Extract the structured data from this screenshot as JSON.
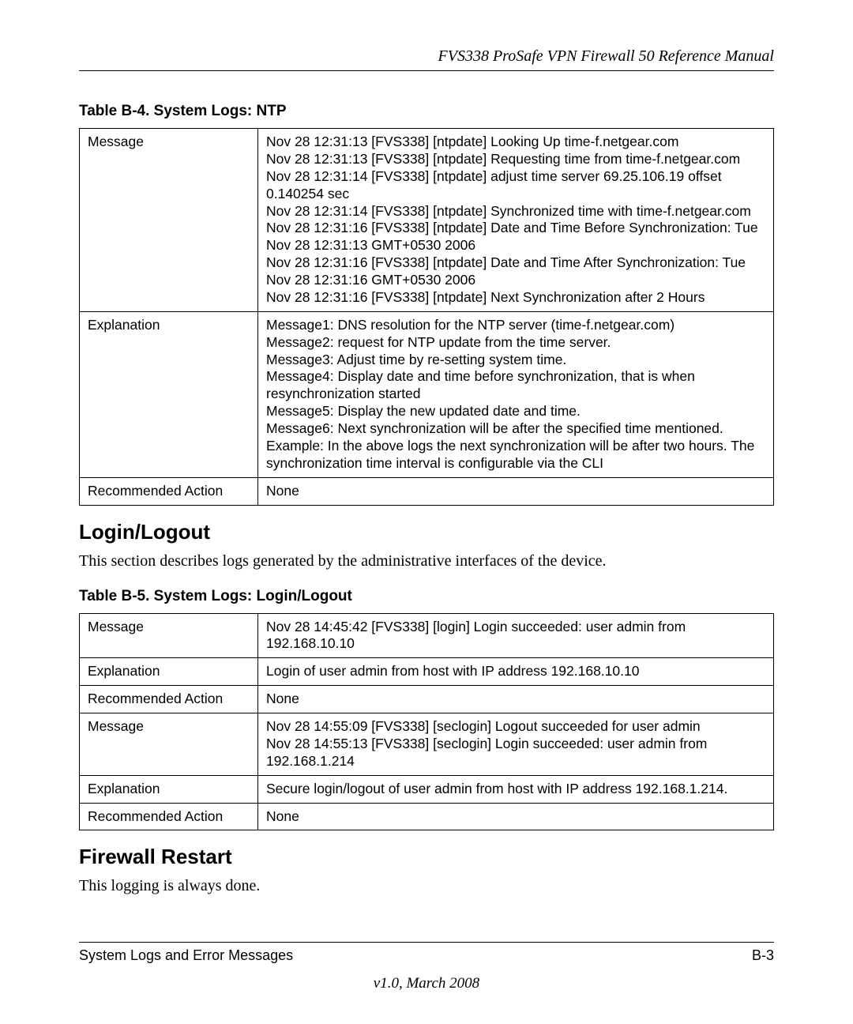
{
  "header": {
    "running_title": "FVS338 ProSafe VPN Firewall 50 Reference Manual"
  },
  "tableB4": {
    "caption": "Table B-4.  System Logs: NTP",
    "rows": [
      {
        "label": "Message",
        "value": "Nov 28 12:31:13 [FVS338] [ntpdate] Looking Up time-f.netgear.com\nNov 28 12:31:13 [FVS338] [ntpdate] Requesting time from time-f.netgear.com\nNov 28 12:31:14 [FVS338] [ntpdate] adjust time server 69.25.106.19 offset 0.140254 sec\nNov 28 12:31:14 [FVS338] [ntpdate] Synchronized time with time-f.netgear.com\nNov 28 12:31:16 [FVS338] [ntpdate] Date and Time Before Synchronization: Tue Nov 28 12:31:13 GMT+0530 2006\nNov 28 12:31:16 [FVS338] [ntpdate] Date and Time After Synchronization: Tue Nov 28 12:31:16 GMT+0530 2006\nNov 28 12:31:16 [FVS338] [ntpdate] Next Synchronization after 2 Hours"
      },
      {
        "label": "Explanation",
        "value": "Message1: DNS resolution for the NTP server (time-f.netgear.com)\nMessage2: request for NTP update from the time server.\nMessage3: Adjust time by re-setting system time.\nMessage4: Display date and time before synchronization, that is when resynchronization started\nMessage5: Display the new updated date and time.\nMessage6: Next synchronization will be after the specified time mentioned.\nExample: In the above logs the next synchronization will be after two hours. The synchronization time interval is configurable via the CLI"
      },
      {
        "label": "Recommended Action",
        "value": "None"
      }
    ]
  },
  "section_login": {
    "heading": "Login/Logout",
    "intro": "This section describes logs generated by the administrative interfaces of the device."
  },
  "tableB5": {
    "caption": "Table B-5.  System Logs: Login/Logout",
    "rows": [
      {
        "label": "Message",
        "value": "Nov 28 14:45:42 [FVS338] [login] Login succeeded: user admin from 192.168.10.10"
      },
      {
        "label": "Explanation",
        "value": "Login of user admin from host with IP address 192.168.10.10"
      },
      {
        "label": "Recommended Action",
        "value": "None"
      },
      {
        "label": "Message",
        "value": "Nov 28 14:55:09 [FVS338] [seclogin] Logout succeeded for user admin\nNov 28 14:55:13 [FVS338] [seclogin] Login succeeded: user admin from 192.168.1.214"
      },
      {
        "label": "Explanation",
        "value": "Secure login/logout of user admin from host with IP address 192.168.1.214."
      },
      {
        "label": "Recommended Action",
        "value": "None"
      }
    ]
  },
  "section_firewall": {
    "heading": "Firewall Restart",
    "intro": "This logging is always done."
  },
  "footer": {
    "left": "System Logs and Error Messages",
    "right": "B-3",
    "center": "v1.0, March 2008"
  }
}
